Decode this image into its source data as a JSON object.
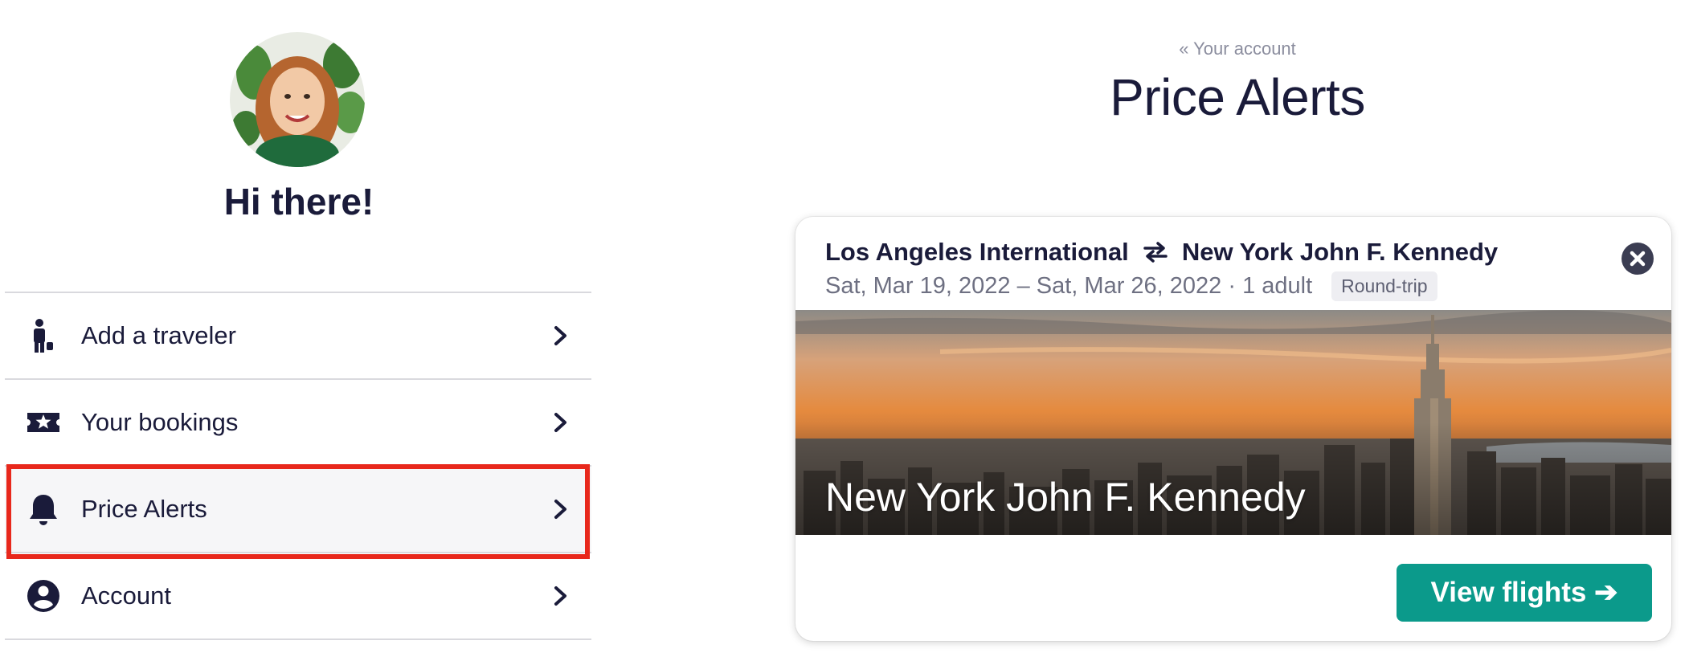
{
  "profile": {
    "greeting": "Hi there!"
  },
  "menu": {
    "items": [
      {
        "label": "Add a traveler",
        "icon": "traveler-icon"
      },
      {
        "label": "Your bookings",
        "icon": "ticket-icon"
      },
      {
        "label": "Price Alerts",
        "icon": "bell-icon",
        "active": true
      },
      {
        "label": "Account",
        "icon": "account-icon"
      }
    ]
  },
  "header": {
    "back_link": "« Your account",
    "title": "Price Alerts"
  },
  "alert": {
    "origin": "Los Angeles International",
    "destination": "New York John F. Kennedy",
    "dates": "Sat, Mar 19, 2022 – Sat, Mar 26, 2022 · 1 adult",
    "trip_type": "Round-trip",
    "image_caption": "New York John F. Kennedy",
    "cta": "View flights ➔"
  },
  "colors": {
    "text_dark": "#1a1b3a",
    "muted": "#8b8d9e",
    "accent_button": "#0b9a8b",
    "highlight_red": "#e8281c"
  }
}
